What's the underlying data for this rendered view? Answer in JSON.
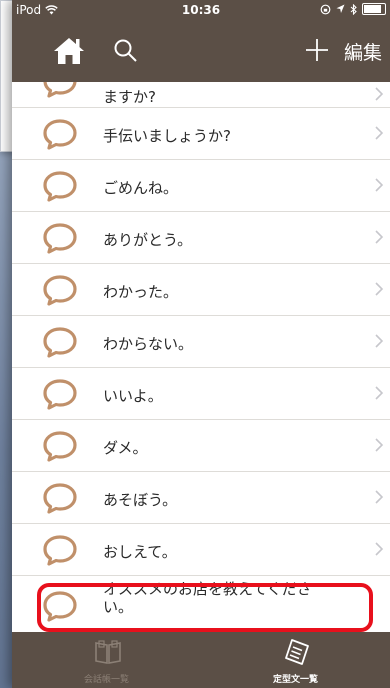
{
  "status": {
    "device": "iPod",
    "time": "10:36"
  },
  "nav": {
    "edit_label": "編集"
  },
  "list": {
    "items": [
      {
        "label": "ますか?"
      },
      {
        "label": "手伝いましょうか?"
      },
      {
        "label": "ごめんね。"
      },
      {
        "label": "ありがとう。"
      },
      {
        "label": "わかった。"
      },
      {
        "label": "わからない。"
      },
      {
        "label": "いいよ。"
      },
      {
        "label": "ダメ。"
      },
      {
        "label": "あそぼう。"
      },
      {
        "label": "おしえて。"
      },
      {
        "label": "オススメのお店を教えてください。"
      }
    ]
  },
  "tabs": [
    {
      "label": "会話帳一覧",
      "active": false
    },
    {
      "label": "定型文一覧",
      "active": true
    }
  ],
  "colors": {
    "bar": "#5b4f46",
    "bubble": "#c0906a",
    "highlight": "#e8101c"
  }
}
